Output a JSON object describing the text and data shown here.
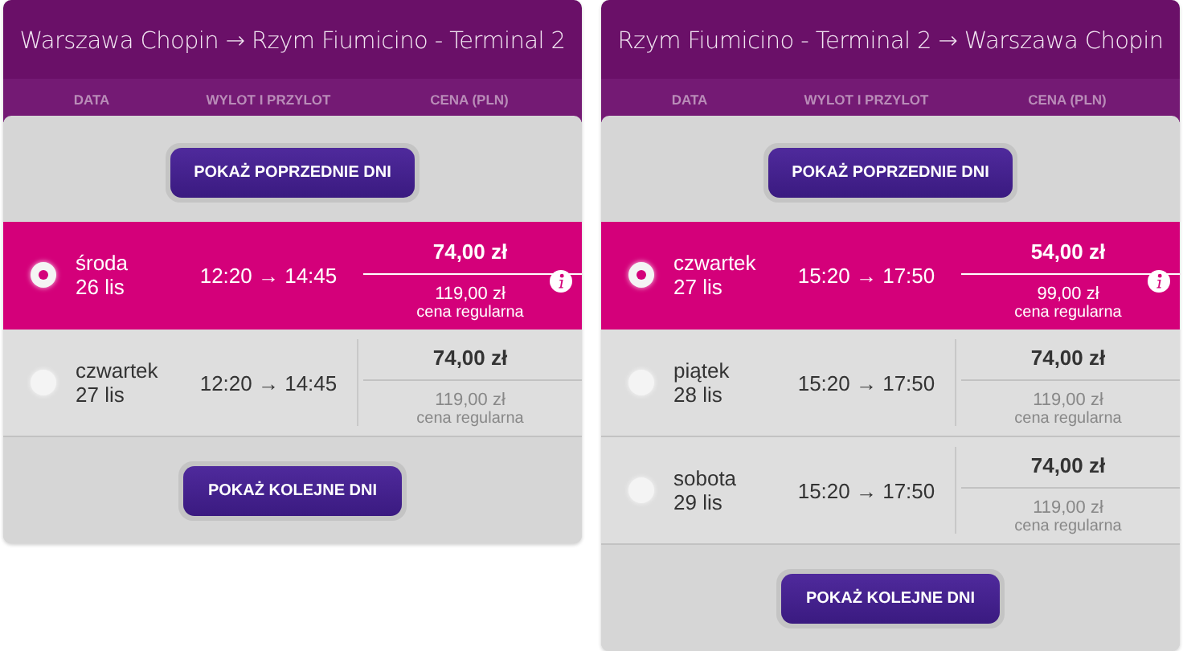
{
  "panels": [
    {
      "title": "Warszawa Chopin → Rzym Fiumicino - Terminal 2",
      "columns": [
        "DATA",
        "WYLOT I PRZYLOT",
        "CENA (PLN)"
      ],
      "prev_button": "POKAŻ POPRZEDNIE DNI",
      "next_button": "POKAŻ KOLEJNE DNI",
      "rows": [
        {
          "day": "środa",
          "date": "26 lis",
          "times": "12:20 → 14:45",
          "price": "74,00 zł",
          "regular_price": "119,00 zł",
          "regular_label": "cena regularna",
          "selected": true
        },
        {
          "day": "czwartek",
          "date": "27 lis",
          "times": "12:20 → 14:45",
          "price": "74,00 zł",
          "regular_price": "119,00 zł",
          "regular_label": "cena regularna",
          "selected": false
        }
      ]
    },
    {
      "title": "Rzym Fiumicino - Terminal 2 → Warszawa Chopin",
      "columns": [
        "DATA",
        "WYLOT I PRZYLOT",
        "CENA (PLN)"
      ],
      "prev_button": "POKAŻ POPRZEDNIE DNI",
      "next_button": "POKAŻ KOLEJNE DNI",
      "rows": [
        {
          "day": "czwartek",
          "date": "27 lis",
          "times": "15:20 → 17:50",
          "price": "54,00 zł",
          "regular_price": "99,00 zł",
          "regular_label": "cena regularna",
          "selected": true
        },
        {
          "day": "piątek",
          "date": "28 lis",
          "times": "15:20 → 17:50",
          "price": "74,00 zł",
          "regular_price": "119,00 zł",
          "regular_label": "cena regularna",
          "selected": false
        },
        {
          "day": "sobota",
          "date": "29 lis",
          "times": "15:20 → 17:50",
          "price": "74,00 zł",
          "regular_price": "119,00 zł",
          "regular_label": "cena regularna",
          "selected": false
        }
      ]
    }
  ]
}
